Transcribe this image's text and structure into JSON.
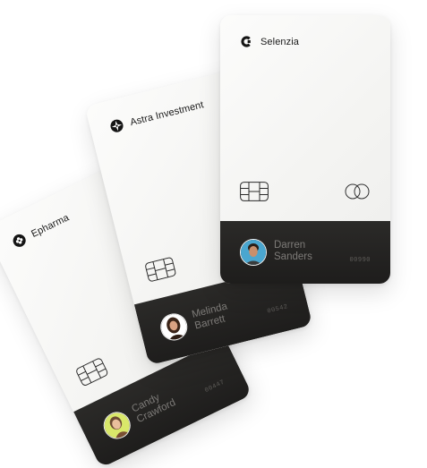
{
  "cards": [
    {
      "id": "epharma",
      "brand": "Epharma",
      "holder_first": "Candy",
      "holder_last": "Crawford",
      "number": "00447",
      "avatar_bg": "#d9e86a",
      "logo_icon": "flower-mark-icon"
    },
    {
      "id": "astra",
      "brand": "Astra Investment",
      "holder_first": "Melinda",
      "holder_last": "Barrett",
      "number": "00542",
      "avatar_bg": "#ffffff",
      "logo_icon": "compass-star-icon"
    },
    {
      "id": "selenzia",
      "brand": "Selenzia",
      "holder_first": "Darren",
      "holder_last": "Sanders",
      "number": "00990",
      "avatar_bg": "#4aa6cf",
      "logo_icon": "c-mark-icon"
    }
  ]
}
